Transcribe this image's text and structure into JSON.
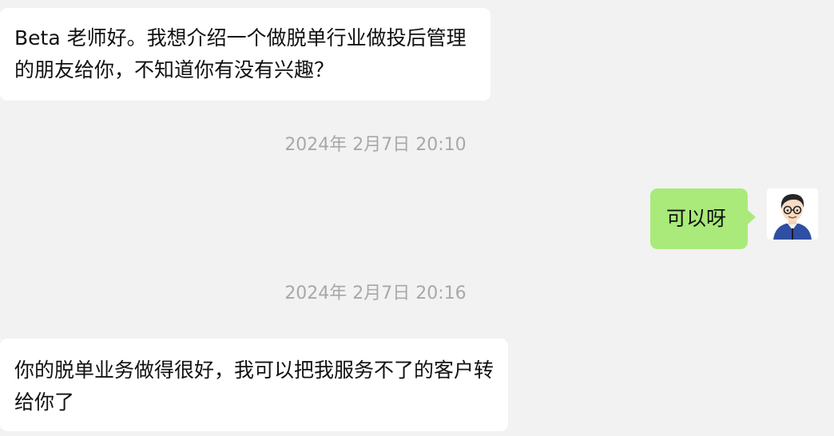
{
  "conversation": {
    "messages": [
      {
        "direction": "incoming",
        "text": "Beta 老师好。我想介绍一个做脱单行业做投后管理的朋友给你，不知道你有没有兴趣？"
      },
      {
        "direction": "outgoing",
        "text": "可以呀"
      },
      {
        "direction": "incoming",
        "text": "你的脱单业务做得很好，我可以把我服务不了的客户转给你了"
      }
    ],
    "timestamps": [
      "2024年 2月7日 20:10",
      "2024年 2月7日 20:16"
    ]
  },
  "avatar": {
    "icon": "cartoon-man-with-glasses-avatar-icon"
  },
  "colors": {
    "background": "#f2f2f2",
    "incoming_bubble": "#ffffff",
    "outgoing_bubble": "#a9ea7a",
    "timestamp_text": "#a8a8a8"
  }
}
